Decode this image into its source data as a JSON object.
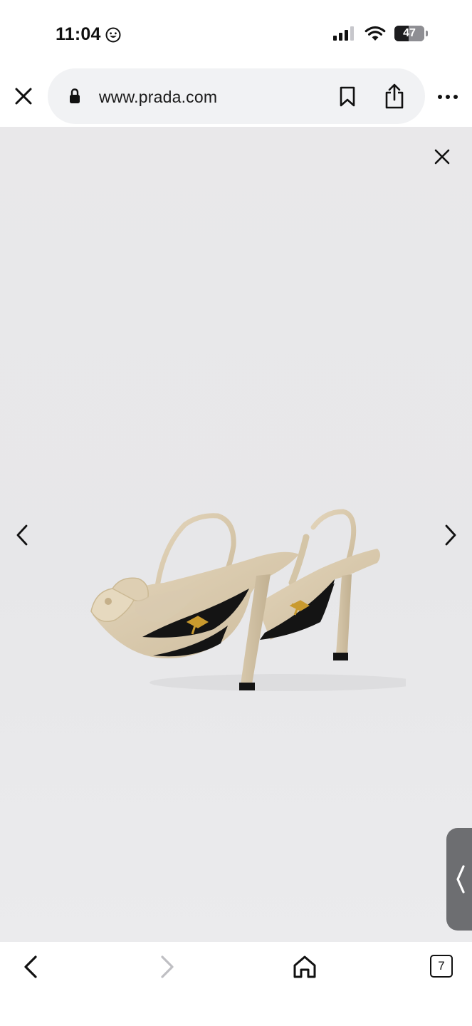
{
  "status_bar": {
    "time": "11:04",
    "battery_percent": "47",
    "battery_level": 0.47,
    "icons": [
      "smiley-icon",
      "signal-icon",
      "wifi-icon",
      "battery-icon"
    ]
  },
  "toolbar": {
    "url": "www.prada.com",
    "icons": [
      "close-icon",
      "lock-icon",
      "bookmark-icon",
      "share-icon",
      "more-icon"
    ]
  },
  "viewer": {
    "image_subject": "beige slingback pumps",
    "icons": [
      "close-icon",
      "chevron-left-icon",
      "chevron-right-icon",
      "side-panel-handle-icon"
    ]
  },
  "bottom_bar": {
    "tab_count": "7",
    "icons": [
      "back-icon",
      "forward-icon",
      "home-icon",
      "tabs-icon"
    ]
  },
  "colors": {
    "viewer_background": "#e8e8ea",
    "shoe_beige": "#dccdb1",
    "sole_black": "#141414",
    "logo_gold": "#c99a2e",
    "handle_gray": "#6d6e71"
  }
}
